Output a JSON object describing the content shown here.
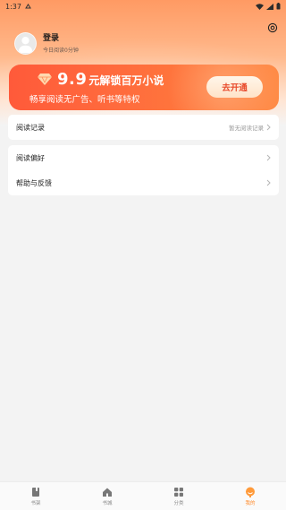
{
  "status_bar": {
    "time": "1:37"
  },
  "header": {
    "login_label": "登录",
    "reading_time": "今日阅读0分钟"
  },
  "vip_banner": {
    "price": "9.9",
    "title_rest": "元解锁百万小说",
    "subtitle": "畅享阅读无广告、听书等特权",
    "button_label": "去开通"
  },
  "menu": {
    "history": {
      "label": "阅读记录",
      "hint": "暂无阅读记录"
    },
    "preferences": {
      "label": "阅读偏好"
    },
    "feedback": {
      "label": "帮助与反馈"
    }
  },
  "tabs": [
    {
      "label": "书架",
      "icon": "bookshelf-icon"
    },
    {
      "label": "书城",
      "icon": "home-icon"
    },
    {
      "label": "分类",
      "icon": "category-grid-icon"
    },
    {
      "label": "我的",
      "icon": "profile-icon"
    }
  ],
  "colors": {
    "accent": "#ff8a2a",
    "banner_start": "#ff5a3a",
    "banner_end": "#ff8b46",
    "button_text": "#e8492a"
  }
}
